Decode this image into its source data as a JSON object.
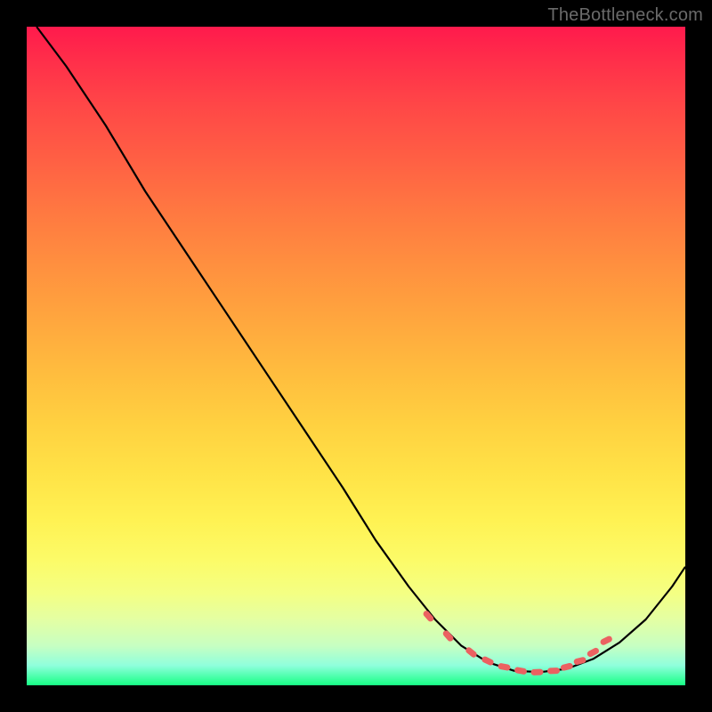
{
  "watermark": {
    "text": "TheBottleneck.com"
  },
  "chart_data": {
    "type": "line",
    "title": "",
    "xlabel": "",
    "ylabel": "",
    "xlim": [
      0,
      100
    ],
    "ylim": [
      0,
      100
    ],
    "series": [
      {
        "name": "curve",
        "x": [
          1.5,
          6,
          12,
          18,
          24,
          30,
          36,
          42,
          48,
          53,
          58,
          62,
          66,
          70,
          74,
          78,
          82,
          86,
          90,
          94,
          98,
          100
        ],
        "values": [
          100,
          94,
          85,
          75,
          66,
          57,
          48,
          39,
          30,
          22,
          15,
          10,
          6,
          3.5,
          2.2,
          2.0,
          2.5,
          4.0,
          6.5,
          10,
          15,
          18
        ]
      }
    ],
    "markers": {
      "name": "highlight-dots",
      "color": "#eb6161",
      "x": [
        61,
        64,
        67.5,
        70,
        72.5,
        75,
        77.5,
        80,
        82,
        84,
        86,
        88
      ],
      "values": [
        10.5,
        7.5,
        5.0,
        3.7,
        2.8,
        2.2,
        2.0,
        2.2,
        2.8,
        3.7,
        5.0,
        6.8
      ]
    }
  }
}
